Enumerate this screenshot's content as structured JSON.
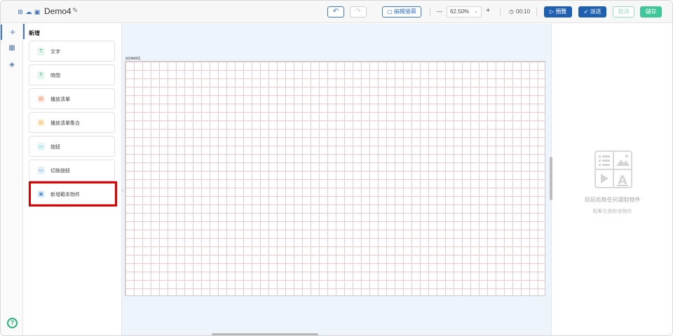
{
  "header": {
    "project_name": "Demo4",
    "undo_label": "↶",
    "redo_label": "↷",
    "edit_screen_label": "編輯螢幕",
    "zoom_minus": "—",
    "zoom_value": "62.50%",
    "zoom_plus": "+",
    "duration": "00:10",
    "preview_label": "預覽",
    "publish_label": "派送",
    "cancel_label": "取消",
    "save_label": "儲存"
  },
  "rail": {
    "items": [
      {
        "icon": "plus-icon",
        "glyph": "+"
      },
      {
        "icon": "grid-icon",
        "glyph": "▦"
      },
      {
        "icon": "layers-icon",
        "glyph": "◈"
      }
    ],
    "help_glyph": "?"
  },
  "panel": {
    "title": "新增",
    "items": [
      {
        "label": "文字",
        "glyph": "T",
        "color": "#2fae70",
        "bg": "#e6f6ee"
      },
      {
        "label": "時間",
        "glyph": "T",
        "color": "#2fae70",
        "bg": "#e6f6ee"
      },
      {
        "label": "播放清單",
        "glyph": "▤",
        "color": "#e87b55",
        "bg": "#fdeee8"
      },
      {
        "label": "播放清單集合",
        "glyph": "▤",
        "color": "#e9a93a",
        "bg": "#fdf4e3"
      },
      {
        "label": "按鈕",
        "glyph": "▭",
        "color": "#4fb7c9",
        "bg": "#e7f6f9"
      },
      {
        "label": "切換按鈕",
        "glyph": "▭",
        "color": "#4a8fd8",
        "bg": "#e8f1fb"
      },
      {
        "label": "新增範本物件",
        "glyph": "▣",
        "color": "#4a8fd8",
        "bg": "#e8f1fb"
      }
    ]
  },
  "canvas": {
    "screen_name": "screen1",
    "collapse_glyph": "‹"
  },
  "right_panel": {
    "empty_title": "目前尚無任何選取物件",
    "empty_subtitle": "點擊左側新增物件"
  },
  "colors": {
    "primary": "#1f5fb0",
    "save": "#3fc79a",
    "highlight": "#e00000"
  }
}
